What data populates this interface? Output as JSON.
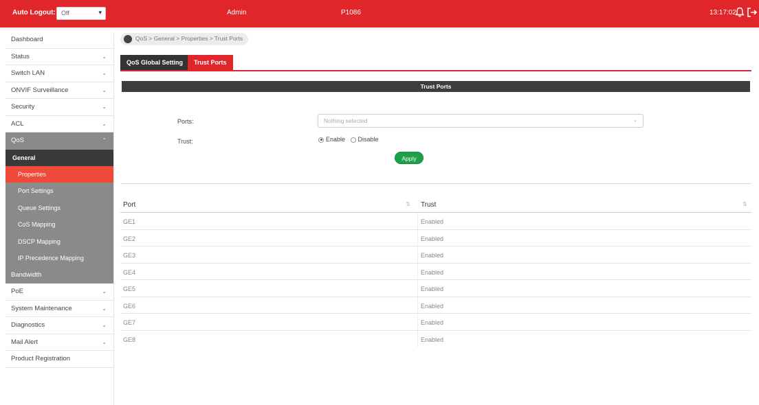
{
  "topbar": {
    "auto_logout_label": "Auto Logout:",
    "auto_logout_value": "Off",
    "user": "Admin",
    "model": "P1086",
    "time": "13:17:02"
  },
  "sidebar": {
    "items": [
      {
        "label": "Dashboard",
        "chevron": ""
      },
      {
        "label": "Status",
        "chevron": "⌄"
      },
      {
        "label": "Switch LAN",
        "chevron": "⌄"
      },
      {
        "label": "ONVIF Surveillance",
        "chevron": "⌄"
      },
      {
        "label": "Security",
        "chevron": "⌄"
      },
      {
        "label": "ACL",
        "chevron": "⌄"
      },
      {
        "label": "QoS",
        "chevron": "⌃"
      }
    ],
    "qos_submenu": {
      "header": "General",
      "items": [
        "Properties",
        "Port Settings",
        "Queue Settings",
        "CoS Mapping",
        "DSCP Mapping",
        "IP Precedence Mapping"
      ],
      "bandwidth": "Bandwidth"
    },
    "items_after": [
      {
        "label": "PoE",
        "chevron": "⌄"
      },
      {
        "label": "System Maintenance",
        "chevron": "⌄"
      },
      {
        "label": "Diagnostics",
        "chevron": "⌄"
      },
      {
        "label": "Mail Alert",
        "chevron": "⌄"
      },
      {
        "label": "Product Registration",
        "chevron": ""
      }
    ]
  },
  "breadcrumb": "QoS > General > Properties > Trust Ports",
  "tabs": [
    "QoS Global Setting",
    "Trust Ports"
  ],
  "section_title": "Trust Ports",
  "form": {
    "ports_label": "Ports:",
    "ports_placeholder": "Nothing selected",
    "trust_label": "Trust:",
    "enable": "Enable",
    "disable": "Disable",
    "apply": "Apply"
  },
  "table": {
    "headers": [
      "Port",
      "Trust"
    ],
    "rows": [
      [
        "GE1",
        "Enabled"
      ],
      [
        "GE2",
        "Enabled"
      ],
      [
        "GE3",
        "Enabled"
      ],
      [
        "GE4",
        "Enabled"
      ],
      [
        "GE5",
        "Enabled"
      ],
      [
        "GE6",
        "Enabled"
      ],
      [
        "GE7",
        "Enabled"
      ],
      [
        "GE8",
        "Enabled"
      ]
    ]
  },
  "colors": {
    "brand_red": "#e0262b",
    "selected_orange": "#f04a3a",
    "apply_green": "#1ea04a",
    "dark_bar": "#3d3d3d"
  }
}
